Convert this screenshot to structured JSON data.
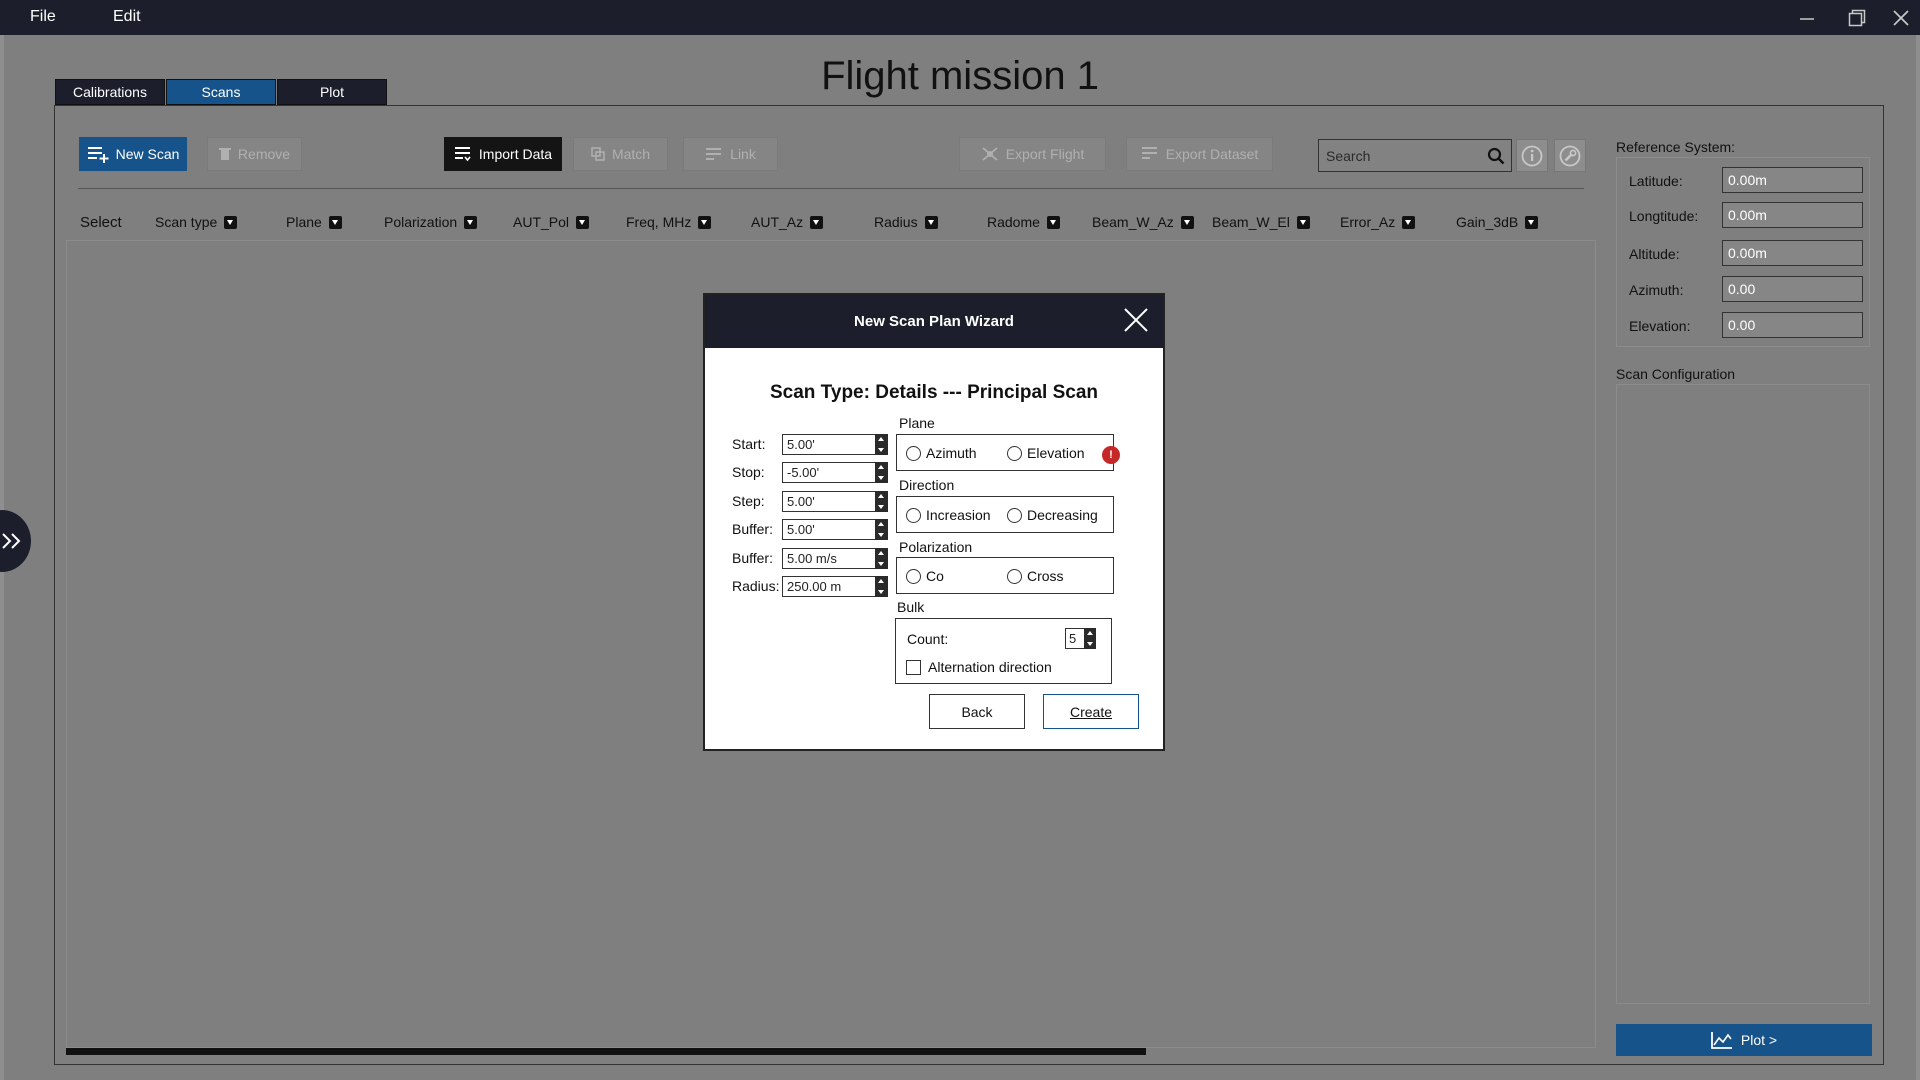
{
  "menu": {
    "file": "File",
    "edit": "Edit"
  },
  "page_title": "Flight mission 1",
  "tabs": [
    {
      "label": "Calibrations"
    },
    {
      "label": "Scans"
    },
    {
      "label": "Plot"
    }
  ],
  "toolbar": {
    "new_scan": "New Scan",
    "remove": "Remove",
    "import_data": "Import Data",
    "match": "Match",
    "link": "Link",
    "export_flight": "Export Flight",
    "export_dataset": "Export Dataset",
    "search_placeholder": "Search"
  },
  "columns": [
    "Select",
    "Scan type",
    "Plane",
    "Polarization",
    "AUT_Pol",
    "Freq, MHz",
    "AUT_Az",
    "Radius",
    "Radome",
    "Beam_W_Az",
    "Beam_W_El",
    "Error_Az",
    "Gain_3dB"
  ],
  "reference": {
    "title": "Reference System:",
    "fields": [
      {
        "label": "Latitude:",
        "value": "0.00m"
      },
      {
        "label": "Longtitude:",
        "value": "0.00m"
      },
      {
        "label": "Altitude:",
        "value": "0.00m"
      },
      {
        "label": "Azimuth:",
        "value": "0.00"
      },
      {
        "label": "Elevation:",
        "value": "0.00"
      }
    ]
  },
  "scan_config": {
    "title": "Scan Configuration"
  },
  "plot_button": "Plot >",
  "modal": {
    "title": "New Scan Plan Wizard",
    "subtitle": "Scan Type: Details --- Principal Scan",
    "fields": [
      {
        "label": "Start:",
        "value": "5.00'"
      },
      {
        "label": "Stop:",
        "value": "-5.00'"
      },
      {
        "label": "Step:",
        "value": "5.00'"
      },
      {
        "label": "Buffer:",
        "value": "5.00'"
      },
      {
        "label": "Buffer:",
        "value": "5.00 m/s"
      },
      {
        "label": "Radius:",
        "value": "250.00 m"
      }
    ],
    "plane": {
      "title": "Plane",
      "options": [
        "Azimuth",
        "Elevation"
      ],
      "error": "!"
    },
    "direction": {
      "title": "Direction",
      "options": [
        "Increasion",
        "Decreasing"
      ]
    },
    "polarization": {
      "title": "Polarization",
      "options": [
        "Co",
        "Cross"
      ]
    },
    "bulk": {
      "title": "Bulk",
      "count_label": "Count:",
      "count_value": "5",
      "alternation_label": "Alternation direction"
    },
    "back": "Back",
    "create": "Create"
  },
  "colors": {
    "titlebar": "#1c1f2b",
    "accent_blue": "#16538a",
    "background": "#7f7f7f",
    "error": "#c62828"
  }
}
